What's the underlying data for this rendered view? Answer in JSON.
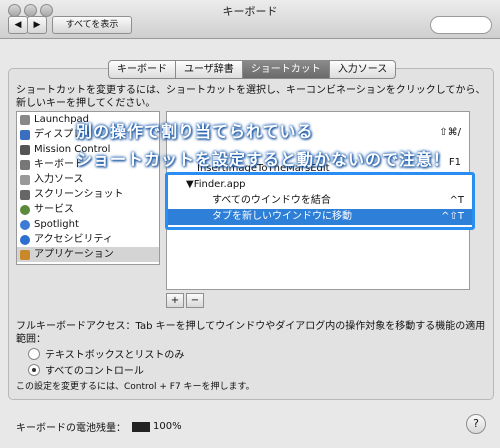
{
  "window": {
    "title": "キーボード"
  },
  "toolbar": {
    "back_label": "◀",
    "forward_label": "▶",
    "show_all_label": "すべてを表示"
  },
  "tabs": [
    {
      "label": "キーボード"
    },
    {
      "label": "ユーザ辞書"
    },
    {
      "label": "ショートカット"
    },
    {
      "label": "入力ソース"
    }
  ],
  "instructions": "ショートカットを変更するには、ショートカットを選択し、キーコンビネーションをクリックしてから、新しいキーを押してください。",
  "categories": [
    {
      "label": "Launchpad",
      "color": "#888888"
    },
    {
      "label": "ディスプレイ",
      "color": "#3a6fc0"
    },
    {
      "label": "Mission Control",
      "color": "#555555"
    },
    {
      "label": "キーボード",
      "color": "#777777"
    },
    {
      "label": "入力ソース",
      "color": "#999999"
    },
    {
      "label": "スクリーンショット",
      "color": "#666666"
    },
    {
      "label": "サービス",
      "color": "#5a8a3a"
    },
    {
      "label": "Spotlight",
      "color": "#3b7bd6"
    },
    {
      "label": "アクセシビリティ",
      "color": "#2b6fd0"
    },
    {
      "label": "アプリケーション",
      "color": "#c9892b"
    }
  ],
  "shortcuts_top": [
    {
      "label": "",
      "key": "⇧⌘/"
    },
    {
      "label": "",
      "key": "F1"
    },
    {
      "label": "InsertImageToTheMarsEdit",
      "key": ""
    }
  ],
  "highlight": {
    "app": "▼Finder.app",
    "row1": {
      "label": "すべてのウインドウを結合",
      "key": "^T"
    },
    "row2": {
      "label": "タブを新しいウインドウに移動",
      "key": "^⇧T"
    }
  },
  "callout": {
    "line1": "別の操作で割り当てられている",
    "line2": "ショートカットを設定すると動かないので注意！"
  },
  "buttons": {
    "add": "+",
    "remove": "−"
  },
  "full_keyboard_access": "フルキーボードアクセス：Tab キーを押してウインドウやダイアログ内の操作対象を移動する機能の適用範囲：",
  "radio": [
    {
      "label": "テキストボックスとリストのみ",
      "selected": false
    },
    {
      "label": "すべてのコントロール",
      "selected": true
    }
  ],
  "note": "この設定を変更するには、Control + F7 キーを押します。",
  "battery": {
    "label": "キーボードの電池残量：",
    "value": "100%"
  },
  "help": "?"
}
